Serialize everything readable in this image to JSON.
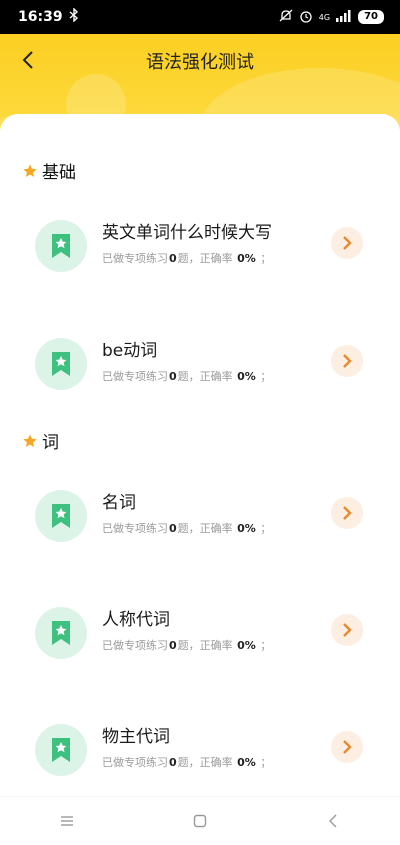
{
  "status_bar": {
    "time": "16:39",
    "network": "4G",
    "battery": "70"
  },
  "header": {
    "title": "语法强化测试"
  },
  "sections": [
    {
      "title": "基础",
      "items": [
        {
          "title": "英文单词什么时候大写",
          "done_prefix": "已做专项练习",
          "done_count": "0",
          "done_suffix": "题，正确率",
          "accuracy": "0%",
          "end": "；"
        },
        {
          "title": "be动词",
          "done_prefix": "已做专项练习",
          "done_count": "0",
          "done_suffix": "题，正确率",
          "accuracy": "0%",
          "end": "；"
        }
      ]
    },
    {
      "title": "词",
      "items": [
        {
          "title": "名词",
          "done_prefix": "已做专项练习",
          "done_count": "0",
          "done_suffix": "题，正确率",
          "accuracy": "0%",
          "end": "；"
        },
        {
          "title": "人称代词",
          "done_prefix": "已做专项练习",
          "done_count": "0",
          "done_suffix": "题，正确率",
          "accuracy": "0%",
          "end": "；"
        },
        {
          "title": "物主代词",
          "done_prefix": "已做专项练习",
          "done_count": "0",
          "done_suffix": "题，正确率",
          "accuracy": "0%",
          "end": "；"
        }
      ]
    }
  ],
  "colors": {
    "header_yellow": "#fccf22",
    "star_orange": "#f5a623",
    "icon_green": "#3ec07e",
    "arrow_orange": "#e8892f"
  }
}
